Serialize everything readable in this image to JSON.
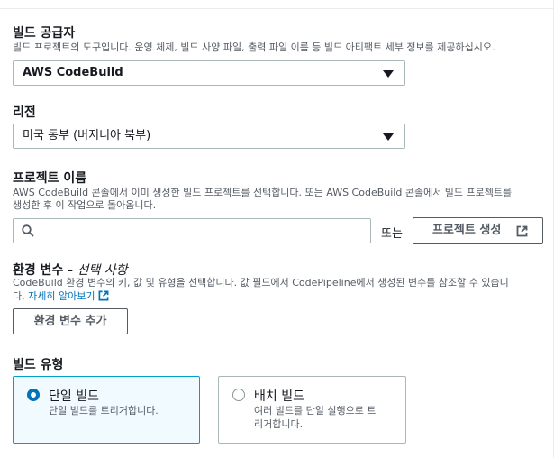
{
  "build_provider": {
    "label": "빌드 공급자",
    "description": "빌드 프로젝트의 도구입니다. 운영 체제, 빌드 사양 파일, 출력 파일 이름 등 빌드 아티팩트 세부 정보를 제공하십시오.",
    "selected": "AWS CodeBuild"
  },
  "region": {
    "label": "리전",
    "selected": "미국 동부 (버지니아 북부)"
  },
  "project_name": {
    "label": "프로젝트 이름",
    "description_line1": "AWS CodeBuild 콘솔에서 이미 생성한 빌드 프로젝트를 선택합니다. 또는 AWS CodeBuild 콘솔에서 빌드 프로젝트를",
    "description_line2": "생성한 후 이 작업으로 돌아옵니다.",
    "search_value": "",
    "or_text": "또는",
    "create_button": "프로젝트 생성"
  },
  "env_vars": {
    "label": "환경 변수 -",
    "optional": "선택 사항",
    "description_line1": "CodeBuild 환경 변수의 키, 값 및 유형을 선택합니다. 값 필드에서 CodePipeline에서 생성된 변수를 참조할 수 있습니",
    "description_line2_prefix": "다.",
    "learn_more": "자세히 알아보기",
    "add_button": "환경 변수 추가"
  },
  "build_type": {
    "label": "빌드 유형",
    "options": [
      {
        "title": "단일 빌드",
        "description": "단일 빌드를 트리거합니다.",
        "selected": true
      },
      {
        "title": "배치 빌드",
        "description_line1": "여러 빌드를 단일 실행으로 트",
        "description_line2": "리거합니다.",
        "selected": false
      }
    ]
  }
}
